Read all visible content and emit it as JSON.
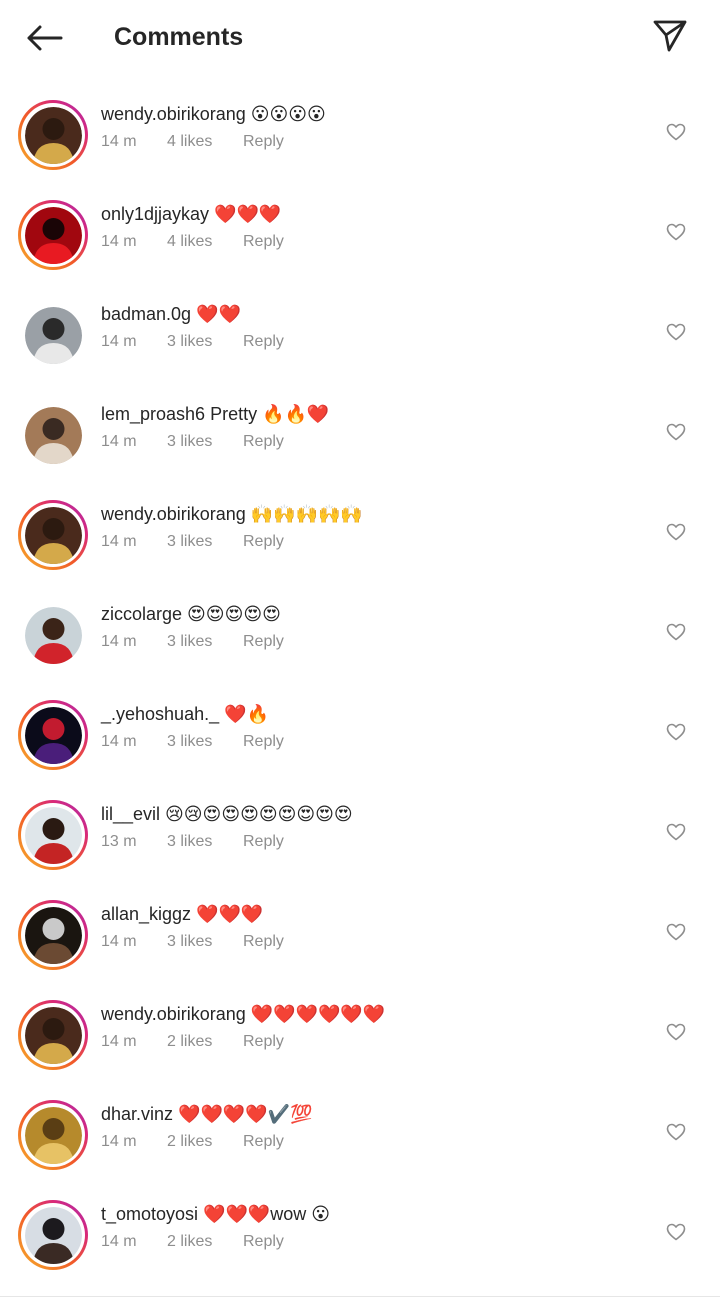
{
  "header": {
    "title": "Comments",
    "back_icon": "arrow-left-icon",
    "send_icon": "paper-plane-icon"
  },
  "colors": {
    "text": "#262626",
    "muted": "#8e8e8e",
    "story_ring": [
      "#f7b32b",
      "#f15a29",
      "#d8297a",
      "#a22ab8"
    ]
  },
  "comments": [
    {
      "username": "wendy.obirikorang",
      "text": "😮😮😮😮",
      "time": "14 m",
      "likes": "4 likes",
      "reply": "Reply",
      "story_ring": true,
      "avatar_colors": [
        "#4a2a1c",
        "#d4a94a",
        "#2c1a10"
      ]
    },
    {
      "username": "only1djjaykay",
      "text": "❤️❤️❤️",
      "time": "14 m",
      "likes": "4 likes",
      "reply": "Reply",
      "story_ring": true,
      "avatar_colors": [
        "#a1070f",
        "#e81a22",
        "#1a0506"
      ]
    },
    {
      "username": "badman.0g",
      "text": "❤️❤️",
      "time": "14 m",
      "likes": "3 likes",
      "reply": "Reply",
      "story_ring": false,
      "avatar_colors": [
        "#9aa0a6",
        "#e8e8e8",
        "#2a2a2a"
      ]
    },
    {
      "username": "lem_proash6",
      "text": "Pretty 🔥🔥❤️",
      "time": "14 m",
      "likes": "3 likes",
      "reply": "Reply",
      "story_ring": false,
      "avatar_colors": [
        "#a37a58",
        "#e3d7c9",
        "#3a2a22"
      ]
    },
    {
      "username": "wendy.obirikorang",
      "text": "🙌🙌🙌🙌🙌",
      "time": "14 m",
      "likes": "3 likes",
      "reply": "Reply",
      "story_ring": true,
      "avatar_colors": [
        "#4a2a1c",
        "#d4a94a",
        "#2c1a10"
      ]
    },
    {
      "username": "ziccolarge",
      "text": "😍😍😍😍😍",
      "time": "14 m",
      "likes": "3 likes",
      "reply": "Reply",
      "story_ring": false,
      "avatar_colors": [
        "#c9d3d8",
        "#d1232b",
        "#3b2418"
      ]
    },
    {
      "username": "_.yehoshuah._",
      "text": "❤️🔥",
      "time": "14 m",
      "likes": "3 likes",
      "reply": "Reply",
      "story_ring": true,
      "avatar_colors": [
        "#0b0b1a",
        "#4a1e7a",
        "#c21b2f"
      ]
    },
    {
      "username": "lil__evil",
      "text": "😢😢😍😍😍😍😍😍😍😍",
      "time": "13 m",
      "likes": "3 likes",
      "reply": "Reply",
      "story_ring": true,
      "avatar_colors": [
        "#dfe6ea",
        "#c42424",
        "#2a1a12"
      ]
    },
    {
      "username": "allan_kiggz",
      "text": "❤️❤️❤️",
      "time": "14 m",
      "likes": "3 likes",
      "reply": "Reply",
      "story_ring": true,
      "avatar_colors": [
        "#1a1510",
        "#6b4a33",
        "#c9c9c9"
      ]
    },
    {
      "username": "wendy.obirikorang",
      "text": "❤️❤️❤️❤️❤️❤️",
      "time": "14 m",
      "likes": "2 likes",
      "reply": "Reply",
      "story_ring": true,
      "avatar_colors": [
        "#4a2a1c",
        "#d4a94a",
        "#2c1a10"
      ]
    },
    {
      "username": "dhar.vinz",
      "text": "❤️❤️❤️❤️✔️💯",
      "time": "14 m",
      "likes": "2 likes",
      "reply": "Reply",
      "story_ring": true,
      "avatar_colors": [
        "#b68a2c",
        "#e7c265",
        "#5a3e14"
      ]
    },
    {
      "username": "t_omotoyosi",
      "text": "❤️❤️❤️wow 😮",
      "time": "14 m",
      "likes": "2 likes",
      "reply": "Reply",
      "story_ring": true,
      "avatar_colors": [
        "#d7dde4",
        "#3a2a24",
        "#1c1a1e"
      ]
    }
  ]
}
